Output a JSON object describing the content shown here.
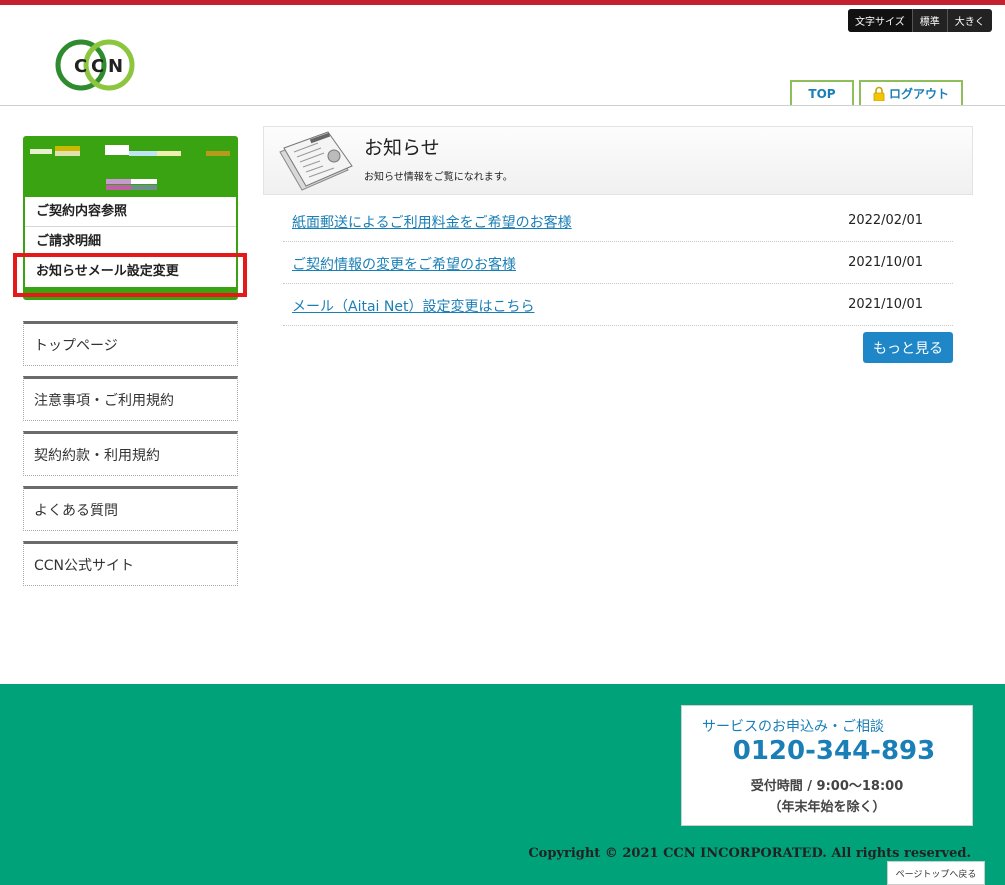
{
  "header": {
    "font_size": {
      "label": "文字サイズ",
      "standard": "標準",
      "large": "大きく"
    },
    "logo_text": [
      "C",
      "C",
      "N"
    ],
    "nav": {
      "top": "TOP",
      "logout": "ログアウト"
    }
  },
  "user_menu": {
    "items": [
      "ご契約内容参照",
      "ご請求明細",
      "お知らせメール設定変更"
    ]
  },
  "side_nav": [
    "トップページ",
    "注意事項・ご利用規約",
    "契約約款・利用規約",
    "よくある質問",
    "CCN公式サイト"
  ],
  "news": {
    "title": "お知らせ",
    "subtitle": "お知らせ情報をご覧になれます。",
    "items": [
      {
        "title": "紙面郵送によるご利用料金をご希望のお客様",
        "date": "2022/02/01"
      },
      {
        "title": "ご契約情報の変更をご希望のお客様",
        "date": "2021/10/01"
      },
      {
        "title": "メール（Aitai Net）設定変更はこちら",
        "date": "2021/10/01"
      }
    ],
    "more": "もっと見る"
  },
  "footer": {
    "contact_label": "サービスのお申込み・ご相談",
    "phone": "0120-344-893",
    "hours": "受付時間 / 9:00〜18:00",
    "note": "（年末年始を除く）",
    "copyright": "Copyright © 2021 CCN INCORPORATED. All rights reserved.",
    "page_top": "ページトップへ戻る"
  },
  "colors": {
    "brand_green": "#3aa312",
    "footer_green": "#00a27a",
    "link_blue": "#1a7fb6",
    "accent_red": "#c4202f"
  }
}
